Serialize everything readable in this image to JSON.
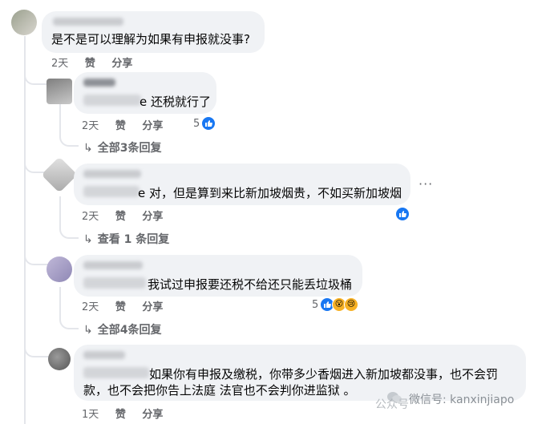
{
  "comments": [
    {
      "text": "是不是可以理解为如果有申报就没事?",
      "time": "2天",
      "like": "赞",
      "share": "分享"
    },
    {
      "text_suffix": "e 还税就行了",
      "time": "2天",
      "like": "赞",
      "share": "分享",
      "reaction_count": "5",
      "replies_link": "全部3条回复"
    },
    {
      "text_suffix": "e 对，但是算到来比新加坡烟贵，不如买新加坡烟",
      "time": "2天",
      "like": "赞",
      "share": "分享",
      "replies_link": "查看 1 条回复",
      "more": "···"
    },
    {
      "text_suffix": "我试过申报要还税不给还只能丢垃圾桶",
      "time": "2天",
      "like": "赞",
      "share": "分享",
      "reaction_count": "5",
      "replies_link": "全部4条回复"
    },
    {
      "line1": "如果你有申报及缴税，你带多少香烟进入新加坡都没事，也不会罚",
      "line2": "款，也不会把你告上法庭 法官也不会判你进监狱 。",
      "time": "1天",
      "like": "赞",
      "share": "分享"
    }
  ],
  "watermark": {
    "label": "微信号: kanxinjiapo",
    "left": "公众号"
  },
  "icons": {
    "like": "thumbs-up-icon",
    "haha": "haha-icon",
    "wow": "wow-icon",
    "sad": "sad-icon",
    "reply_arrow": "reply-arrow-icon"
  },
  "colors": {
    "bubble": "#f0f2f5",
    "like_blue": "#1877f2",
    "meta_gray": "#65676b"
  }
}
